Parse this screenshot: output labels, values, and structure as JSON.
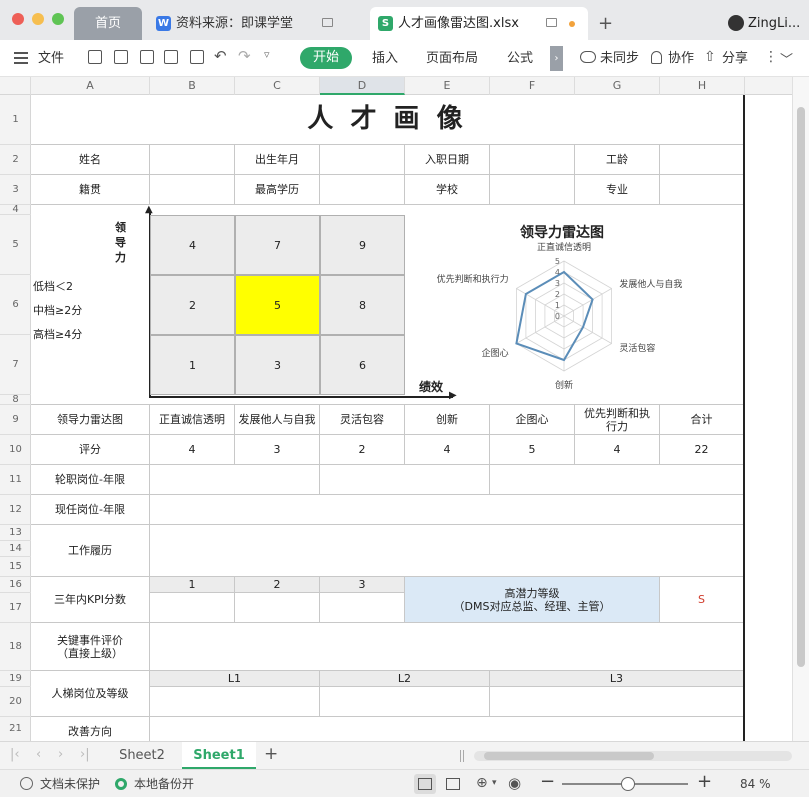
{
  "window": {
    "tabs": [
      {
        "label": "首页"
      },
      {
        "label": "资料来源：即课学堂",
        "badge": "W"
      },
      {
        "label": "人才画像雷达图.xlsx",
        "badge": "S"
      }
    ],
    "new_tab": "+",
    "user": "ZingLi..."
  },
  "toolbar": {
    "file_menu": "文件",
    "start": "开始",
    "insert": "插入",
    "page_layout": "页面布局",
    "formula": "公式",
    "more": "›",
    "unsynced": "未同步",
    "collab": "协作",
    "share": "分享"
  },
  "grid": {
    "columns": [
      "A",
      "B",
      "C",
      "D",
      "E",
      "F",
      "G",
      "H"
    ],
    "rows": [
      "1",
      "2",
      "3",
      "4",
      "5",
      "6",
      "7",
      "8",
      "9",
      "10",
      "11",
      "12",
      "13",
      "14",
      "15",
      "16",
      "17",
      "18",
      "19",
      "20",
      "21"
    ]
  },
  "sheet": {
    "title": "人 才 画 像",
    "name_label": "姓名",
    "birth_label": "出生年月",
    "join_label": "入职日期",
    "tenure_label": "工龄",
    "origin_label": "籍贯",
    "edu_label": "最高学历",
    "school_label": "学校",
    "major_label": "专业",
    "matrix": {
      "y_label_1": "领",
      "y_label_2": "导",
      "y_label_3": "力",
      "x_label": "绩效",
      "legend_low": "低档＜2",
      "legend_mid": "中档≥2分",
      "legend_high": "高档≥4分",
      "cells": [
        "4",
        "7",
        "9",
        "2",
        "5",
        "8",
        "1",
        "3",
        "6"
      ],
      "highlight_color": "#ffff00"
    },
    "radar_header": "领导力雷达图",
    "dimensions": [
      "正直诚信透明",
      "发展他人与自我",
      "灵活包容",
      "创新",
      "企图心",
      "优先判断和执行力"
    ],
    "total_label": "合计",
    "score_label": "评分",
    "scores": [
      "4",
      "3",
      "2",
      "4",
      "5",
      "4"
    ],
    "total": "22",
    "rotation_label": "轮职岗位-年限",
    "current_label": "现任岗位-年限",
    "history_label": "工作履历",
    "kpi_label": "三年内KPI分数",
    "kpi_years": [
      "1",
      "2",
      "3"
    ],
    "potential_label": "高潜力等级",
    "potential_sub": "（DMS对应总监、经理、主管）",
    "potential_value": "S",
    "key_event_label": "关键事件评价",
    "key_event_sub": "（直接上级）",
    "ladder_label": "人梯岗位及等级",
    "ladder_levels": [
      "L1",
      "L2",
      "L3"
    ],
    "improve_label": "改善方向"
  },
  "chart_data": {
    "type": "radar",
    "title": "领导力雷达图",
    "categories": [
      "正直诚信透明",
      "发展他人与自我",
      "灵活包容",
      "创新",
      "企图心",
      "优先判断和执行力"
    ],
    "values": [
      4,
      3,
      2,
      4,
      5,
      4
    ],
    "rlim": [
      0,
      5
    ],
    "ticks": [
      "0",
      "1",
      "2",
      "3",
      "4",
      "5"
    ],
    "series_color": "#5b8db8"
  },
  "sheets": {
    "tabs": [
      "Sheet2",
      "Sheet1"
    ],
    "active": "Sheet1",
    "add": "+"
  },
  "status": {
    "protect": "文档未保护",
    "backup": "本地备份开",
    "zoom": "84 %",
    "minus": "−",
    "plus": "+"
  }
}
